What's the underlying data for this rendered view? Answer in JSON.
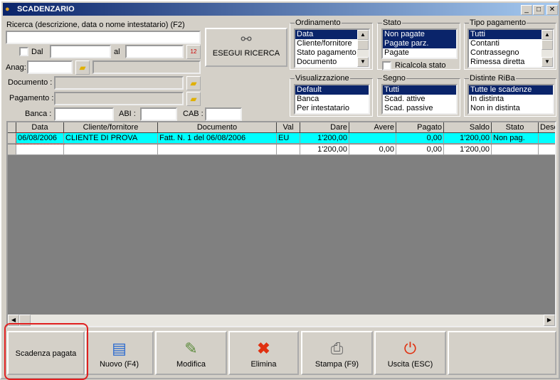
{
  "window": {
    "title": "SCADENZARIO",
    "min": "_",
    "max": "□",
    "close": "✕"
  },
  "search": {
    "label": "Ricerca (descrizione, data o nome intestatario) (F2)",
    "value": "",
    "dal_label": "Dal",
    "al_label": "al",
    "anag_label": "Anag:",
    "documento_label": "Documento :",
    "pagamento_label": "Pagamento :",
    "banca_label": "Banca :",
    "abi_label": "ABI :",
    "cab_label": "CAB :",
    "execute_label": "ESEGUI RICERCA",
    "calendar_text": "12"
  },
  "groups": {
    "ordinamento": {
      "title": "Ordinamento",
      "items": [
        "Data",
        "Cliente/fornitore",
        "Stato pagamento",
        "Documento"
      ],
      "selected": [
        0
      ]
    },
    "stato": {
      "title": "Stato",
      "items": [
        "Non pagate",
        "Pagate parz.",
        "Pagate"
      ],
      "selected": [
        0,
        1
      ],
      "ricalcola_label": "Ricalcola stato"
    },
    "tipo_pagamento": {
      "title": "Tipo pagamento",
      "items": [
        "Tutti",
        "Contanti",
        "Contrassegno",
        "Rimessa diretta"
      ],
      "selected": [
        0
      ]
    },
    "visualizzazione": {
      "title": "Visualizzazione",
      "items": [
        "Default",
        "Banca",
        "Per intestatario"
      ],
      "selected": [
        0
      ]
    },
    "segno": {
      "title": "Segno",
      "items": [
        "Tutti",
        "Scad. attive",
        "Scad. passive"
      ],
      "selected": [
        0
      ]
    },
    "distinte": {
      "title": "Distinte RiBa",
      "items": [
        "Tutte le scadenze",
        "In distinta",
        "Non in distinta"
      ],
      "selected": [
        0
      ]
    }
  },
  "table": {
    "columns": [
      "Data",
      "Cliente/fornitore",
      "Documento",
      "Val",
      "Dare",
      "Avere",
      "Pagato",
      "Saldo",
      "Stato",
      "Desc"
    ],
    "rows": [
      [
        "06/08/2006",
        "CLIENTE DI PROVA",
        "Fatt. N. 1 del 06/08/2006",
        "EU",
        "1'200,00",
        "",
        "0,00",
        "1'200,00",
        "Non pag.",
        ""
      ]
    ],
    "totals": [
      "",
      "",
      "",
      "",
      "1'200,00",
      "0,00",
      "0,00",
      "1'200,00",
      "",
      ""
    ],
    "highlight_color": "#00ffff"
  },
  "buttons": {
    "scadenza_pagata": "Scadenza pagata",
    "nuovo": "Nuovo (F4)",
    "modifica": "Modifica",
    "elimina": "Elimina",
    "stampa": "Stampa (F9)",
    "uscita": "Uscita (ESC)"
  }
}
